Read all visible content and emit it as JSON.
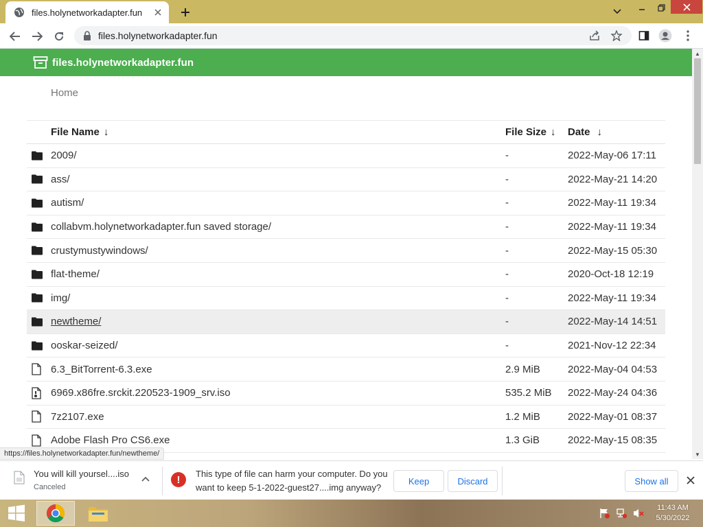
{
  "browser": {
    "tab_title": "files.holynetworkadapter.fun",
    "url": "files.holynetworkadapter.fun",
    "status_url": "https://files.holynetworkadapter.fun/newtheme/"
  },
  "site": {
    "name": "files.holynetworkadapter.fun",
    "brand_color": "#4cae4f",
    "breadcrumb": "Home"
  },
  "table": {
    "headers": {
      "name": "File Name",
      "size": "File Size",
      "date": "Date",
      "sort_arrow": "↓"
    },
    "rows": [
      {
        "type": "folder",
        "name": "2009/",
        "size": "-",
        "date": "2022-May-06 17:11"
      },
      {
        "type": "folder",
        "name": "ass/",
        "size": "-",
        "date": "2022-May-21 14:20"
      },
      {
        "type": "folder",
        "name": "autism/",
        "size": "-",
        "date": "2022-May-11 19:34"
      },
      {
        "type": "folder",
        "name": "collabvm.holynetworkadapter.fun saved storage/",
        "size": "-",
        "date": "2022-May-11 19:34"
      },
      {
        "type": "folder",
        "name": "crustymustywindows/",
        "size": "-",
        "date": "2022-May-15 05:30"
      },
      {
        "type": "folder",
        "name": "flat-theme/",
        "size": "-",
        "date": "2020-Oct-18 12:19"
      },
      {
        "type": "folder",
        "name": "img/",
        "size": "-",
        "date": "2022-May-11 19:34"
      },
      {
        "type": "folder",
        "name": "newtheme/",
        "size": "-",
        "date": "2022-May-14 14:51",
        "hover": true
      },
      {
        "type": "folder",
        "name": "ooskar-seized/",
        "size": "-",
        "date": "2021-Nov-12 22:34"
      },
      {
        "type": "file",
        "name": "6.3_BitTorrent-6.3.exe",
        "size": "2.9 MiB",
        "date": "2022-May-04 04:53"
      },
      {
        "type": "disk",
        "name": "6969.x86fre.srckit.220523-1909_srv.iso",
        "size": "535.2 MiB",
        "date": "2022-May-24 04:36"
      },
      {
        "type": "file",
        "name": "7z2107.exe",
        "size": "1.2 MiB",
        "date": "2022-May-01 08:37"
      },
      {
        "type": "file",
        "name": "Adobe Flash Pro CS6.exe",
        "size": "1.3 GiB",
        "date": "2022-May-15 08:35"
      }
    ]
  },
  "downloads": {
    "item_name": "You will kill yoursel....iso",
    "item_status": "Canceled",
    "warning_text": "This type of file can harm your computer. Do you want to keep 5-1-2022-guest27....img anyway?",
    "keep_label": "Keep",
    "discard_label": "Discard",
    "show_all_label": "Show all"
  },
  "taskbar": {
    "time": "11:43 AM",
    "date": "5/30/2022"
  }
}
